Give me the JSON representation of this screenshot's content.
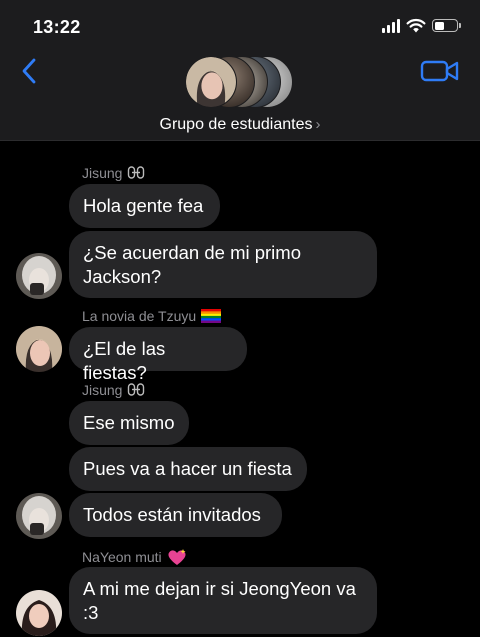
{
  "status_bar": {
    "time": "13:22",
    "battery_level_pct": 45
  },
  "header": {
    "group_name": "Grupo de estudiantes",
    "chevron": "›",
    "icons": {
      "back": "chevron-left-icon",
      "video": "video-camera-icon"
    }
  },
  "messages": [
    {
      "sender": "Jisung",
      "sender_icon": "chain-link-icon",
      "text": "Hola gente fea"
    },
    {
      "text_line1": "¿Se acuerdan de mi primo",
      "text_line2": "Jackson?"
    },
    {
      "sender": "La novia de Tzuyu",
      "sender_icon": "rainbow-flag-icon",
      "text": "¿El de las fiestas?"
    },
    {
      "sender": "Jisung",
      "sender_icon": "chain-link-icon",
      "text": "Ese mismo"
    },
    {
      "text": "Pues va a hacer un fiesta"
    },
    {
      "text": "Todos están invitados"
    },
    {
      "sender": "NaYeon muti",
      "sender_icon": "sparkling-heart-icon",
      "text_line1": "A mi me dejan ir si JeongYeon va",
      "text_line2": ":3"
    }
  ],
  "colors": {
    "accent": "#2f7cf6",
    "bubble": "#262628",
    "header_bg": "#1c1c1e",
    "sender_text": "#8e8e93"
  }
}
